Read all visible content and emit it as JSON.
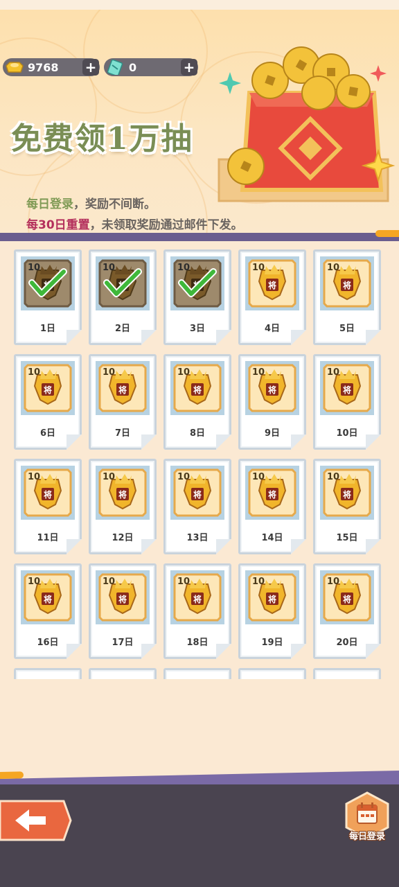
{
  "header": {
    "gold": {
      "value": "9768",
      "icon": "gold-ingot-icon"
    },
    "tickets": {
      "value": "0",
      "icon": "ticket-icon"
    },
    "plus_label": "+"
  },
  "banner": {
    "headline": "免费领1万抽",
    "line1_highlight": "每日登录",
    "line1_rest": "，奖励不间断。",
    "line2_highlight": "每30日重置",
    "line2_rest": "，未领取奖励通过邮件下发。"
  },
  "rewards": {
    "badge": "10",
    "seal": "将",
    "days": [
      {
        "label": "1日",
        "claimed": true
      },
      {
        "label": "2日",
        "claimed": true
      },
      {
        "label": "3日",
        "claimed": true
      },
      {
        "label": "4日",
        "claimed": false
      },
      {
        "label": "5日",
        "claimed": false
      },
      {
        "label": "6日",
        "claimed": false
      },
      {
        "label": "7日",
        "claimed": false
      },
      {
        "label": "8日",
        "claimed": false
      },
      {
        "label": "9日",
        "claimed": false
      },
      {
        "label": "10日",
        "claimed": false
      },
      {
        "label": "11日",
        "claimed": false
      },
      {
        "label": "12日",
        "claimed": false
      },
      {
        "label": "13日",
        "claimed": false
      },
      {
        "label": "14日",
        "claimed": false
      },
      {
        "label": "15日",
        "claimed": false
      },
      {
        "label": "16日",
        "claimed": false
      },
      {
        "label": "17日",
        "claimed": false
      },
      {
        "label": "18日",
        "claimed": false
      },
      {
        "label": "19日",
        "claimed": false
      },
      {
        "label": "20日",
        "claimed": false
      }
    ]
  },
  "footer": {
    "back_icon": "arrow-left-icon",
    "daily_login_label": "每日登录",
    "daily_login_icon": "calendar-icon"
  },
  "colors": {
    "accent_purple": "#6a5d8f",
    "accent_orange": "#f5a623",
    "highlight_green": "#7f9a55",
    "highlight_red": "#b4305c"
  }
}
